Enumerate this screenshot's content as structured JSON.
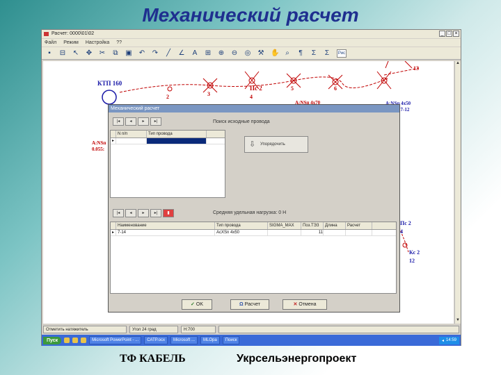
{
  "slide": {
    "title": "Механический расчет",
    "footer_left": "ТФ КАБЕЛЬ",
    "footer_right": "Укрсельэнергопроект"
  },
  "app": {
    "window_title": "Расчет: 0000\\01\\02",
    "menu": [
      "Файл",
      "Режим",
      "Настройка",
      "??"
    ],
    "toolbar_icons": [
      "save-icon",
      "print-icon",
      "select-icon",
      "move-icon",
      "cut-icon",
      "copy-icon",
      "paste-icon",
      "undo-icon",
      "redo-icon",
      "line-icon",
      "angle-icon",
      "text-icon",
      "grid-icon",
      "zoom-in-icon",
      "zoom-out-icon",
      "zoom-fit-icon",
      "tools-icon",
      "hand-icon",
      "find-icon",
      "paragraph-icon",
      "sigma-icon",
      "sum-icon"
    ],
    "toolbar_combo": "Рис",
    "status": [
      "Отметить натяжитель",
      "Угол 24 град",
      "Н:700"
    ]
  },
  "drawing": {
    "labels": {
      "ktp": "КТП 160",
      "pole2": "Пс 2",
      "pole4": "4",
      "pole3": "3",
      "pole5": "5",
      "pole6": "6",
      "pole13": "13",
      "wire1": "А:NSп 4x70",
      "wire2": "А:NSп 4x50",
      "span": "Пр.л. 7-12",
      "left1": "А:NSп",
      "left2": "0.055:",
      "right_pole": "Пс 2",
      "right4": "4",
      "right_num": "12",
      "right_pole2": "Кс 2",
      "n1": "2",
      "n2": "1"
    }
  },
  "dialog": {
    "title": "Механический расчет",
    "top_label": "Поиск исходные провода",
    "calc_button": "Упорядочить",
    "top_grid": {
      "columns": [
        "N п/п",
        "Тип провода"
      ],
      "rows": [
        [
          "",
          ""
        ]
      ]
    },
    "bottom_label": "Средняя удельная нагрузка: 0 Н",
    "bottom_grid": {
      "columns": [
        "Наименование",
        "Тип провода",
        "SIGMA_MAX",
        "Поз.ТЭЗ",
        "Длина",
        "Расчет"
      ],
      "rows": [
        [
          "7-14",
          "АсXSn 4x50",
          "",
          "11",
          "",
          ""
        ]
      ]
    },
    "buttons": {
      "ok": "OK",
      "calc": "Расчет",
      "cancel": "Отмена"
    }
  },
  "taskbar": {
    "start": "Пуск",
    "tasks": [
      "Microsoft PowerPoint - ...",
      "CATP.ocx",
      "Microsoft ...",
      "MLOpa"
    ],
    "search": "Поиск",
    "clock": "14:59"
  },
  "colors": {
    "title": "#1f2f8f",
    "cad_lines": "#c00000",
    "cad_blue": "#1a1aa8",
    "taskbar": "#3a6ad8"
  }
}
